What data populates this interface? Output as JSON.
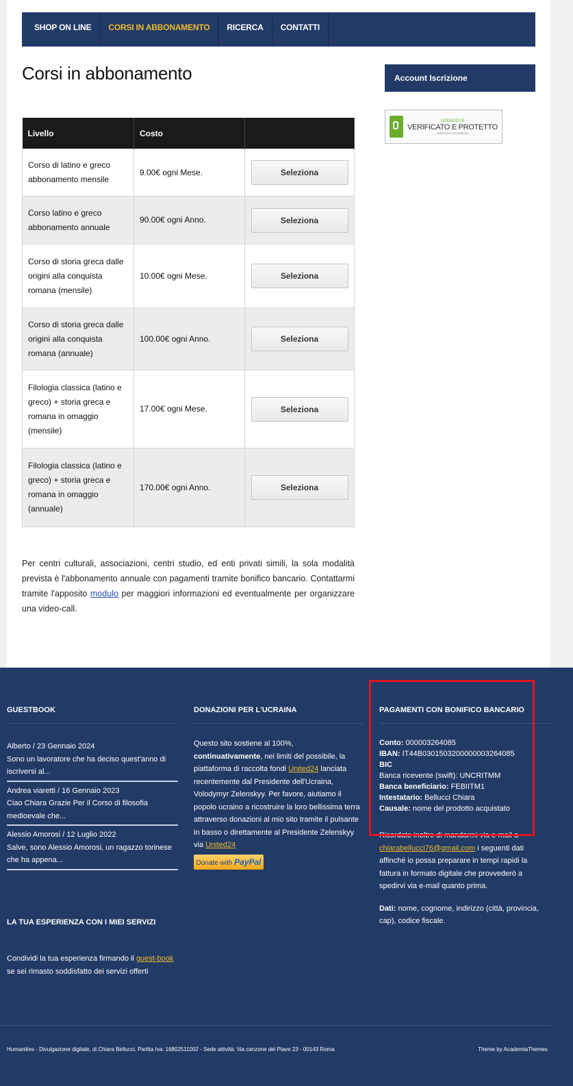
{
  "nav": {
    "items": [
      {
        "label": "SHOP ON LINE"
      },
      {
        "label": "CORSI IN ABBONAMENTO"
      },
      {
        "label": "RICERCA"
      },
      {
        "label": "CONTATTI"
      }
    ]
  },
  "page_title": "Corsi in abbonamento",
  "table": {
    "headers": [
      "Livello",
      "Costo",
      ""
    ],
    "rows": [
      {
        "level": "Corso di latino e greco abbonamento mensile",
        "cost": "9.00€ ogni Mese.",
        "button": "Seleziona"
      },
      {
        "level": "Corso latino e greco abbonamento annuale",
        "cost": "90.00€ ogni Anno.",
        "button": "Seleziona"
      },
      {
        "level": "Corso di storia greca dalle origini alla conquista romana (mensile)",
        "cost": "10.00€ ogni Mese.",
        "button": "Seleziona"
      },
      {
        "level": "Corso di storia greca dalle origini alla conquista romana (annuale)",
        "cost": "100.00€ ogni Anno.",
        "button": "Seleziona"
      },
      {
        "level": "Filologia classica (latino e greco) + storia greca e romana in omaggio (mensile)",
        "cost": "17.00€ ogni Mese.",
        "button": "Seleziona"
      },
      {
        "level": "Filologia classica (latino e greco) + storia greca e romana in omaggio (annuale)",
        "cost": "170.00€ ogni Anno.",
        "button": "Seleziona"
      }
    ]
  },
  "intro": {
    "before_link": "Per centri culturali, associazioni, centri studio, ed enti privati simili, la sola modalità prevista è l'abbonamento annuale con pagamenti tramite bonifico bancario. Contattarmi tramite l'apposito ",
    "link": "modulo",
    "after_link": " per maggiori informazioni ed eventualmente per organizzare una video-call."
  },
  "sidebar": {
    "heading": "Account Iscrizione",
    "seal": {
      "top": "GODADDY®",
      "main": "VERIFICATO E PROTETTO",
      "sub": "VERIFICA DI SICUREZZA"
    }
  },
  "footer": {
    "guestbook": {
      "title": "GUESTBOOK",
      "entries": [
        {
          "meta": "Alberto / 23 Gennaio 2024",
          "text": "Sono un lavoratore che ha deciso quest'anno di iscriversi al..."
        },
        {
          "meta": "Andrea viaretti / 16 Gennaio 2023",
          "text": "Ciao Chiara Grazie Per il Corso di filosofia medioevale che..."
        },
        {
          "meta": "Alessio Amorosi / 12 Luglio 2022",
          "text": "Salve, sono Alessio Amorosi, un ragazzo torinese che ha appena..."
        }
      ]
    },
    "experience": {
      "title": "LA TUA ESPERIENZA CON I MIEI SERVIZI",
      "before_link": "Condividi la tua esperienza firmando il ",
      "link": "guest-book",
      "after_link": " se sei rimasto soddisfatto dei servizi offerti"
    },
    "donations": {
      "title": "DONAZIONI PER L'UCRAINA",
      "p1": "Questo sito sostiene al 100%, ",
      "p1_bold": "continuativamente",
      "p2": ", nei limiti del possibile, la piattaforma di raccolta fondi ",
      "link1": "United24",
      "p3": " lanciata recentemente dal Presidente dell'Ucraina, Volodymyr Zelenskyy. Per favore, aiutiamo il popolo ucraino a ricostruire la loro bellissima terra attraverso donazioni al mio sito tramite il pulsante in basso o direttamente al Presidente Zelenskyy via ",
      "link2": "United24",
      "paypal_small": "Donate with",
      "paypal_brand": "PayPal"
    },
    "bank": {
      "title": "PAGAMENTI CON BONIFICO BANCARIO",
      "conto_label": "Conto:",
      "conto": " 000003264085",
      "iban_label": "IBAN:",
      "iban": " IT44B0301503200000003264085",
      "bic_label": "BIC",
      "swift": "Banca ricevente (swift): UNCRITMM",
      "benef_label": "Banca beneficiario:",
      "benef": " FEBIITM1",
      "holder_label": "Intestatario:",
      "holder": " Bellucci Chiara",
      "causale_label": "Causale:",
      "causale": " nome del prodotto acquistato",
      "remind_before": "Ricordate inoltre di mandarmi via e-mail a ",
      "email": "chiarabellucci76@gmail.com",
      "remind_after": " i seguenti dati affinché io possa preparare in tempi rapidi la fattura in formato digitale che provvederò a spedirvi via e-mail quanto prima.",
      "dati_label": "Dati:",
      "dati": " nome, cognome, indirizzo (città, provincia, cap), codice fiscale."
    },
    "credits": "Humanities - Divulgazione digitale, di Chiara Bellucci, Partita Iva: 16802511002 - Sede attività: Via canzone del Piave 23 - 00143 Roma",
    "theme": "Theme by AcademiaThemes"
  }
}
